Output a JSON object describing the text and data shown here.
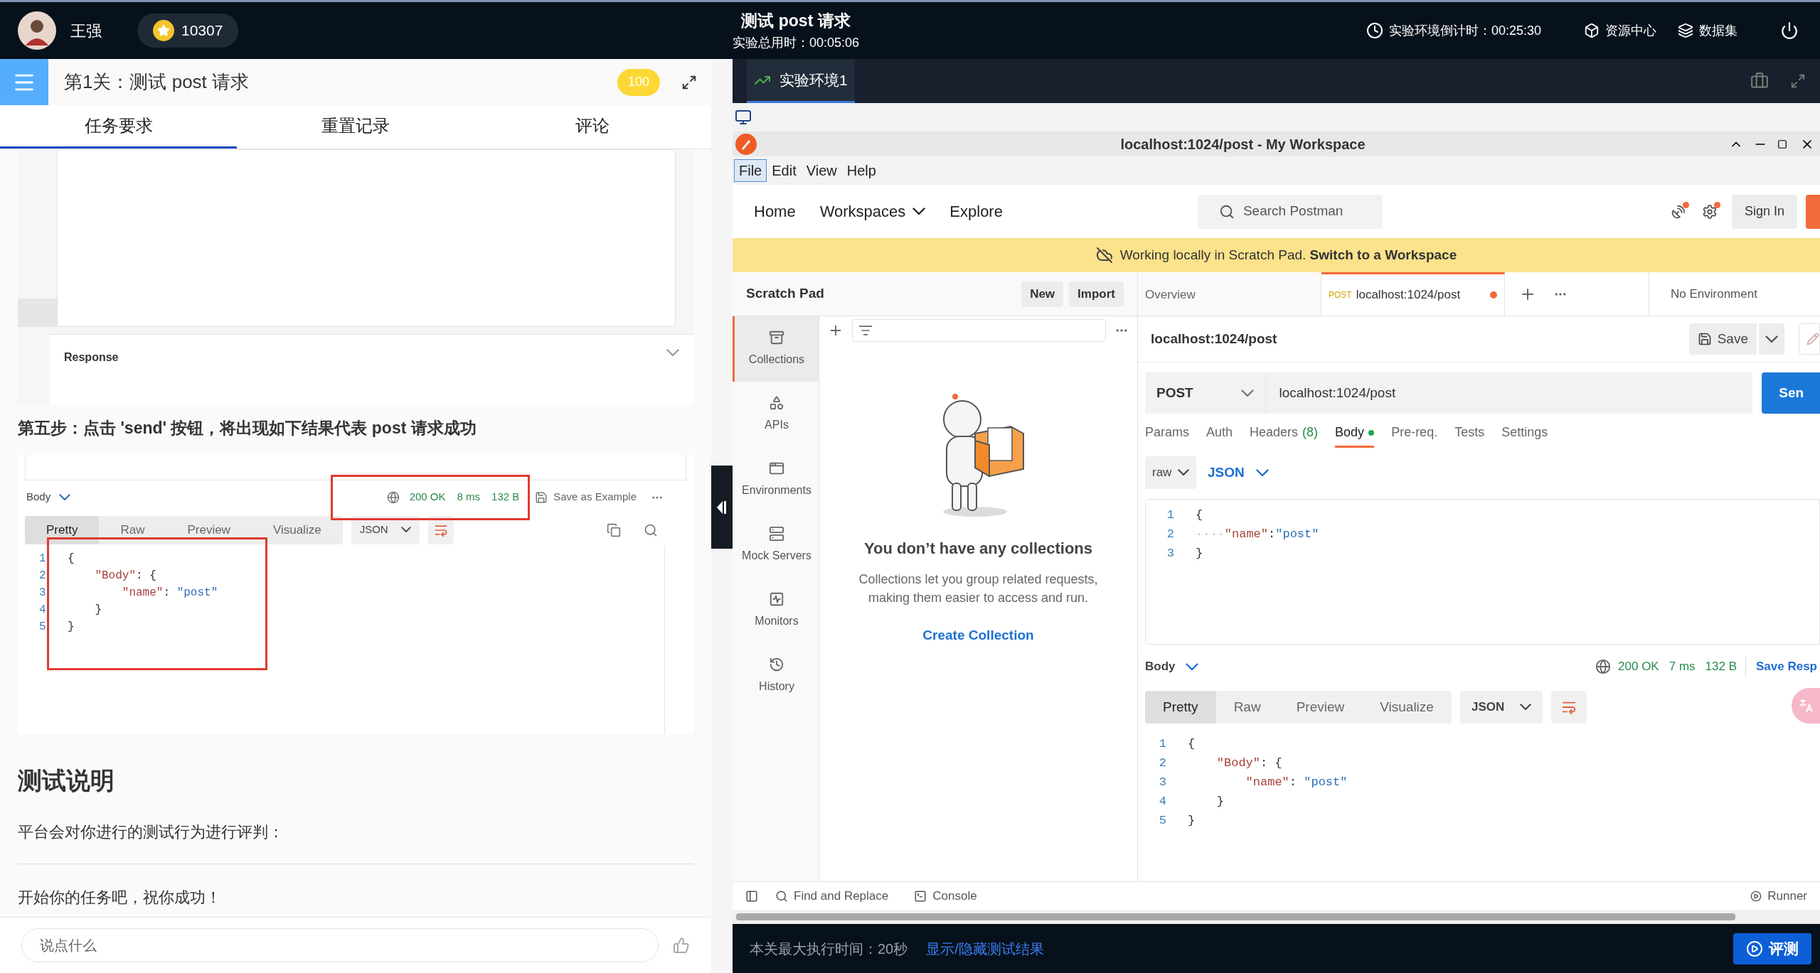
{
  "top_bar": {
    "user_name": "王强",
    "coins": "10307",
    "title": "测试 post 请求",
    "elapsed": "实验总用时：00:05:06",
    "countdown": "实验环境倒计时：00:25:30",
    "links": [
      {
        "label": "资源中心",
        "kind": "resources"
      },
      {
        "label": "数据集",
        "kind": "datasets"
      }
    ]
  },
  "task_panel": {
    "title": "第1关：测试 post 请求",
    "score": "100",
    "tabs": [
      {
        "label": "任务要求",
        "selected": true
      },
      {
        "label": "重置记录",
        "selected": false
      },
      {
        "label": "评论",
        "selected": false
      }
    ],
    "screenshot_1": {
      "section": "Response"
    },
    "step": "第五步：点击 'send' 按钮，将出现如下结果代表 post 请求成功",
    "screenshot_2": {
      "body_label": "Body",
      "status": "200 OK",
      "time": "8 ms",
      "size": "132 B",
      "save": "Save as Example",
      "view_tabs": [
        {
          "label": "Pretty",
          "selected": true
        },
        {
          "label": "Raw",
          "selected": false
        },
        {
          "label": "Preview",
          "selected": false
        },
        {
          "label": "Visualize",
          "selected": false
        }
      ],
      "format": "JSON",
      "code": [
        {
          "number": "1",
          "tokens": [
            {
              "text": "{",
              "kind": "punct"
            }
          ]
        },
        {
          "number": "2",
          "tokens": [
            {
              "text": "    \"Body\"",
              "kind": "key"
            },
            {
              "text": ": {",
              "kind": "punct"
            }
          ]
        },
        {
          "number": "3",
          "tokens": [
            {
              "text": "        \"name\"",
              "kind": "key"
            },
            {
              "text": ": ",
              "kind": "punct"
            },
            {
              "text": "\"post\"",
              "kind": "string"
            }
          ]
        },
        {
          "number": "4",
          "tokens": [
            {
              "text": "    }",
              "kind": "punct"
            }
          ]
        },
        {
          "number": "5",
          "tokens": [
            {
              "text": "}",
              "kind": "punct"
            }
          ]
        }
      ]
    },
    "heading": "测试说明",
    "paragraphs": [
      "平台会对你进行的测试行为进行评判：",
      "开始你的任务吧，祝你成功！"
    ],
    "comment_placeholder": "说点什么"
  },
  "env_tabs": [
    {
      "label": "实验环境1",
      "selected": true
    }
  ],
  "postman": {
    "window_title": "localhost:1024/post - My Workspace",
    "menu": [
      {
        "label": "File",
        "selected": true
      },
      {
        "label": "Edit",
        "selected": false
      },
      {
        "label": "View",
        "selected": false
      },
      {
        "label": "Help",
        "selected": false
      }
    ],
    "nav": [
      {
        "label": "Home",
        "dropdown": false
      },
      {
        "label": "Workspaces",
        "dropdown": true
      },
      {
        "label": "Explore",
        "dropdown": false
      }
    ],
    "search_placeholder": "Search Postman",
    "sign_in": "Sign In",
    "banner": "Working locally in Scratch Pad. **Switch to a Workspace**",
    "scratch_pad": "Scratch Pad",
    "scratch_buttons": [
      "New",
      "Import"
    ],
    "sidebar": [
      {
        "label": "Collections",
        "kind": "collections",
        "selected": true
      },
      {
        "label": "APIs",
        "kind": "apis",
        "selected": false
      },
      {
        "label": "Environments",
        "kind": "environments",
        "selected": false
      },
      {
        "label": "Mock Servers",
        "kind": "mock",
        "selected": false
      },
      {
        "label": "Monitors",
        "kind": "monitors",
        "selected": false
      },
      {
        "label": "History",
        "kind": "history",
        "selected": false
      }
    ],
    "empty_title": "You don’t have any collections",
    "empty_text": "Collections let you group related requests, making them easier to access and run.",
    "create_link": "Create Collection",
    "tabs": [
      {
        "label": "Overview",
        "selected": false
      },
      {
        "method": "POST",
        "label": "localhost:1024/post",
        "selected": true,
        "unsaved": true
      }
    ],
    "environment": "No Environment",
    "request_name": "localhost:1024/post",
    "save": "Save",
    "method": "POST",
    "url": "localhost:1024/post",
    "send": "Sen",
    "request_tabs": [
      {
        "label": "Params",
        "selected": false
      },
      {
        "label": "Auth",
        "selected": false
      },
      {
        "label": "Headers",
        "count": "(8)",
        "selected": false
      },
      {
        "label": "Body",
        "selected": true,
        "dot": true
      },
      {
        "label": "Pre-req.",
        "selected": false
      },
      {
        "label": "Tests",
        "selected": false
      },
      {
        "label": "Settings",
        "selected": false
      }
    ],
    "body_mode": "raw",
    "body_format": "JSON",
    "request_code": [
      {
        "number": "1",
        "tokens": [
          {
            "text": "{",
            "kind": "punct"
          }
        ]
      },
      {
        "number": "2",
        "tokens": [
          {
            "text": "····",
            "kind": "ws"
          },
          {
            "text": "\"name\"",
            "kind": "key"
          },
          {
            "text": ":",
            "kind": "punct"
          },
          {
            "text": "\"post\"",
            "kind": "string"
          }
        ]
      },
      {
        "number": "3",
        "tokens": [
          {
            "text": "}",
            "kind": "punct"
          }
        ]
      }
    ],
    "response": {
      "body_label": "Body",
      "status": "200 OK",
      "time": "7 ms",
      "size": "132 B",
      "save": "Save Resp",
      "view_tabs": [
        {
          "label": "Pretty",
          "selected": true
        },
        {
          "label": "Raw",
          "selected": false
        },
        {
          "label": "Preview",
          "selected": false
        },
        {
          "label": "Visualize",
          "selected": false
        }
      ],
      "format": "JSON",
      "code": [
        {
          "number": "1",
          "tokens": [
            {
              "text": "{",
              "kind": "punct"
            }
          ]
        },
        {
          "number": "2",
          "tokens": [
            {
              "text": "    \"Body\"",
              "kind": "key"
            },
            {
              "text": ": {",
              "kind": "punct"
            }
          ]
        },
        {
          "number": "3",
          "tokens": [
            {
              "text": "        \"name\"",
              "kind": "key"
            },
            {
              "text": ": ",
              "kind": "punct"
            },
            {
              "text": "\"post\"",
              "kind": "string"
            }
          ]
        },
        {
          "number": "4",
          "tokens": [
            {
              "text": "    }",
              "kind": "punct"
            }
          ]
        },
        {
          "number": "5",
          "tokens": [
            {
              "text": "}",
              "kind": "punct"
            }
          ]
        }
      ]
    },
    "status_bar": {
      "left": [
        "Find and Replace",
        "Console"
      ],
      "right": "Runner"
    }
  },
  "footer": {
    "time_limit": "本关最大执行时间：20秒",
    "toggle_link": "显示/隐藏测试结果",
    "evaluate": "评测"
  }
}
